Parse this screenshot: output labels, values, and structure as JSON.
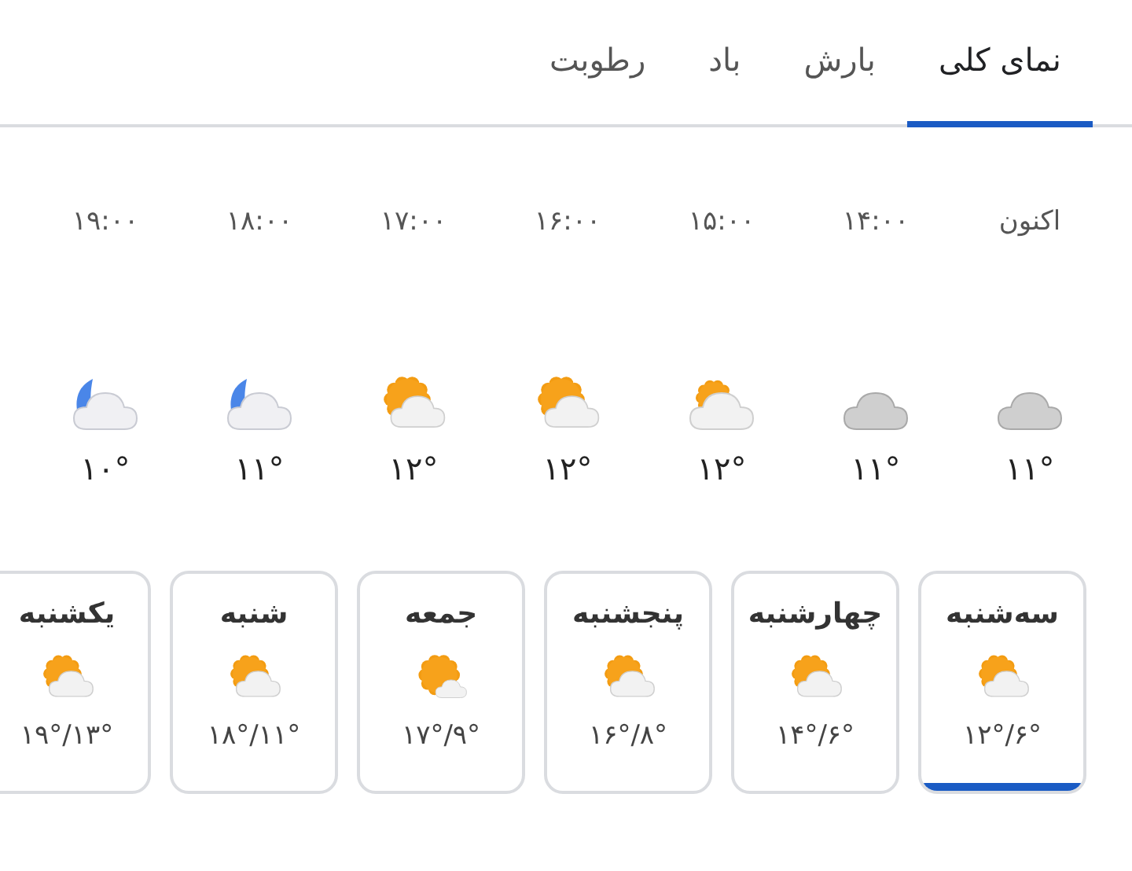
{
  "tabs": [
    {
      "label": "نمای کلی",
      "selected": true
    },
    {
      "label": "بارش",
      "selected": false
    },
    {
      "label": "باد",
      "selected": false
    },
    {
      "label": "رطوبت",
      "selected": false
    }
  ],
  "hourly": [
    {
      "time": "اکنون",
      "kind": "cloudy",
      "temp": "۱۱°"
    },
    {
      "time": "۱۴:۰۰",
      "kind": "cloudy",
      "temp": "۱۱°"
    },
    {
      "time": "۱۵:۰۰",
      "kind": "partly-sunny",
      "temp": "۱۲°"
    },
    {
      "time": "۱۶:۰۰",
      "kind": "sunny",
      "temp": "۱۲°"
    },
    {
      "time": "۱۷:۰۰",
      "kind": "sunny",
      "temp": "۱۲°"
    },
    {
      "time": "۱۸:۰۰",
      "kind": "night",
      "temp": "۱۱°"
    },
    {
      "time": "۱۹:۰۰",
      "kind": "night",
      "temp": "۱۰°"
    }
  ],
  "daily": [
    {
      "day": "سه‌شنبه",
      "kind": "sunny",
      "range": "۱۲°/۶°",
      "selected": true
    },
    {
      "day": "چهارشنبه",
      "kind": "sunny",
      "range": "۱۴°/۶°",
      "selected": false
    },
    {
      "day": "پنجشنبه",
      "kind": "sunny",
      "range": "۱۶°/۸°",
      "selected": false
    },
    {
      "day": "جمعه",
      "kind": "mostly-sunny",
      "range": "۱۷°/۹°",
      "selected": false
    },
    {
      "day": "شنبه",
      "kind": "sunny",
      "range": "۱۸°/۱۱°",
      "selected": false
    },
    {
      "day": "یکشنبه",
      "kind": "sunny",
      "range": "۱۹°/۱۳°",
      "selected": false
    }
  ]
}
